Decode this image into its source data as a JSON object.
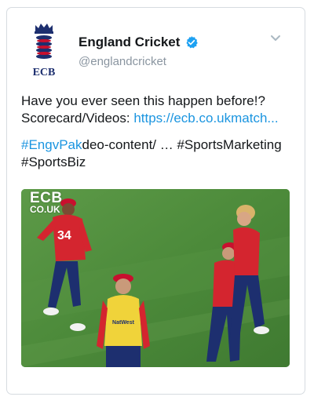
{
  "tweet": {
    "display_name": "England Cricket",
    "handle": "@englandcricket",
    "logo_text": "ECB",
    "text_line1": "Have you ever seen this happen before!?",
    "text_line2_prefix": "Scorecard/Videos: ",
    "text_line2_link": "https://ecb.co.ukmatch...",
    "text_line3_hashtag": "#EngvPak",
    "text_line3_rest": "deo-content/ … #SportsMarketing",
    "text_line4": "#SportsBiz",
    "media": {
      "watermark_line1": "ECB",
      "watermark_line2": "CO.UK",
      "shirt_number": "34",
      "bib_sponsor": "NatWest"
    }
  },
  "colors": {
    "link": "#1b95e0",
    "verified": "#1da1f2",
    "text": "#14171a",
    "muted": "#8a95a0",
    "border": "#d6dbe0",
    "pitch_green": "#4b8a3c",
    "ecb_navy": "#1d2f6f",
    "ecb_red": "#c8102e"
  },
  "icons": [
    "ecb-crest-icon",
    "verified-badge-icon",
    "chevron-down-icon"
  ]
}
